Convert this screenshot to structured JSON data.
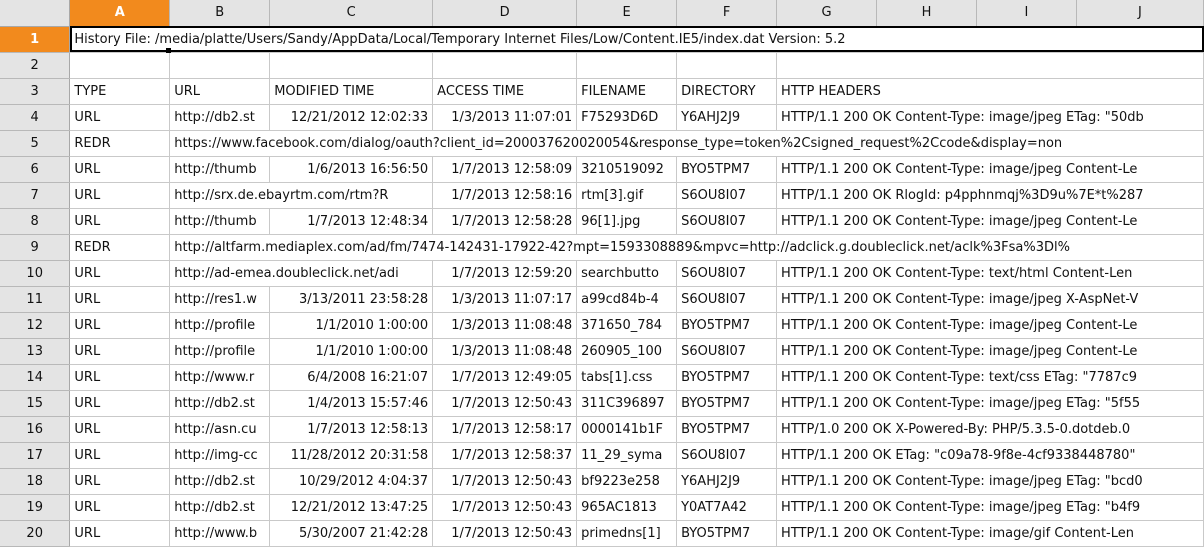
{
  "columns": [
    "A",
    "B",
    "C",
    "D",
    "E",
    "F",
    "G",
    "H",
    "I",
    "J"
  ],
  "active_column": "A",
  "active_row": 1,
  "rows": [
    {
      "n": "1",
      "spill": "History File: /media/platte/Users/Sandy/AppData/Local/Temporary Internet Files/Low/Content.IE5/index.dat Version: 5.2"
    },
    {
      "n": "2",
      "cells": [
        "",
        "",
        "",
        "",
        "",
        "",
        ""
      ]
    },
    {
      "n": "3",
      "cells": [
        "TYPE",
        "URL",
        "MODIFIED TIME",
        "ACCESS TIME",
        "FILENAME",
        "DIRECTORY",
        "HTTP HEADERS"
      ]
    },
    {
      "n": "4",
      "cells": [
        "URL",
        "http://db2.st",
        "12/21/2012 12:02:33",
        "1/3/2013 11:07:01",
        "F75293D6D",
        "Y6AHJ2J9",
        "HTTP/1.1 200 OK  Content-Type: image/jpeg  ETag: \"50db"
      ]
    },
    {
      "n": "5",
      "type": "REDR",
      "spillB": "https://www.facebook.com/dialog/oauth?client_id=200037620020054&response_type=token%2Csigned_request%2Ccode&display=non"
    },
    {
      "n": "6",
      "cells": [
        "URL",
        "http://thumb",
        "1/6/2013 16:56:50",
        "1/7/2013 12:58:09",
        "3210519092",
        "BYO5TPM7",
        "HTTP/1.1 200 OK  Content-Type: image/jpeg  Content-Le"
      ]
    },
    {
      "n": "7",
      "cells": [
        "URL",
        "http://srx.de.ebayrtm.com/rtm?R",
        "1/7/2013 12:58:16",
        "rtm[3].gif",
        "S6OU8I07",
        "HTTP/1.1 200 OK  RlogId: p4pphnmqj%3D9u%7E*t%287"
      ]
    },
    {
      "n": "8",
      "cells": [
        "URL",
        "http://thumb",
        "1/7/2013 12:48:34",
        "1/7/2013 12:58:28",
        "96[1].jpg",
        "S6OU8I07",
        "HTTP/1.1 200 OK  Content-Type: image/jpeg  Content-Le"
      ]
    },
    {
      "n": "9",
      "type": "REDR",
      "spillB": "http://altfarm.mediaplex.com/ad/fm/7474-142431-17922-42?mpt=1593308889&mpvc=http://adclick.g.doubleclick.net/aclk%3Fsa%3Dl%"
    },
    {
      "n": "10",
      "cells": [
        "URL",
        "http://ad-emea.doubleclick.net/adi",
        "1/7/2013 12:59:20",
        "searchbutto",
        "S6OU8I07",
        "HTTP/1.1 200 OK  Content-Type: text/html  Content-Len"
      ]
    },
    {
      "n": "11",
      "cells": [
        "URL",
        "http://res1.w",
        "3/13/2011 23:58:28",
        "1/3/2013 11:07:17",
        "a99cd84b-4",
        "S6OU8I07",
        "HTTP/1.1 200 OK  Content-Type: image/jpeg  X-AspNet-V"
      ]
    },
    {
      "n": "12",
      "cells": [
        "URL",
        "http://profile",
        "1/1/2010 1:00:00",
        "1/3/2013 11:08:48",
        "371650_784",
        "BYO5TPM7",
        "HTTP/1.1 200 OK  Content-Type: image/jpeg  Content-Le"
      ]
    },
    {
      "n": "13",
      "cells": [
        "URL",
        "http://profile",
        "1/1/2010 1:00:00",
        "1/3/2013 11:08:48",
        "260905_100",
        "S6OU8I07",
        "HTTP/1.1 200 OK  Content-Type: image/jpeg  Content-Le"
      ]
    },
    {
      "n": "14",
      "cells": [
        "URL",
        "http://www.r",
        "6/4/2008 16:21:07",
        "1/7/2013 12:49:05",
        "tabs[1].css",
        "BYO5TPM7",
        "HTTP/1.1 200 OK  Content-Type: text/css  ETag: \"7787c9"
      ]
    },
    {
      "n": "15",
      "cells": [
        "URL",
        "http://db2.st",
        "1/4/2013 15:57:46",
        "1/7/2013 12:50:43",
        "311C396897",
        "BYO5TPM7",
        "HTTP/1.1 200 OK  Content-Type: image/jpeg  ETag: \"5f55"
      ]
    },
    {
      "n": "16",
      "cells": [
        "URL",
        "http://asn.cu",
        "1/7/2013 12:58:13",
        "1/7/2013 12:58:17",
        "0000141b1F",
        "BYO5TPM7",
        "HTTP/1.0 200 OK  X-Powered-By: PHP/5.3.5-0.dotdeb.0"
      ]
    },
    {
      "n": "17",
      "cells": [
        "URL",
        "http://img-cc",
        "11/28/2012 20:31:58",
        "1/7/2013 12:58:37",
        "11_29_syma",
        "S6OU8I07",
        "HTTP/1.1 200 OK  ETag: \"c09a78-9f8e-4cf9338448780\""
      ]
    },
    {
      "n": "18",
      "cells": [
        "URL",
        "http://db2.st",
        "10/29/2012 4:04:37",
        "1/7/2013 12:50:43",
        "bf9223e258",
        "Y6AHJ2J9",
        "HTTP/1.1 200 OK  Content-Type: image/jpeg  ETag: \"bcd0"
      ]
    },
    {
      "n": "19",
      "cells": [
        "URL",
        "http://db2.st",
        "12/21/2012 13:47:25",
        "1/7/2013 12:50:43",
        "965AC1813",
        "Y0AT7A42",
        "HTTP/1.1 200 OK  Content-Type: image/jpeg  ETag: \"b4f9"
      ]
    },
    {
      "n": "20",
      "cells": [
        "URL",
        "http://www.b",
        "5/30/2007 21:42:28",
        "1/7/2013 12:50:43",
        "primedns[1]",
        "BYO5TPM7",
        "HTTP/1.1 200 OK  Content-Type: image/gif  Content-Len"
      ]
    }
  ]
}
